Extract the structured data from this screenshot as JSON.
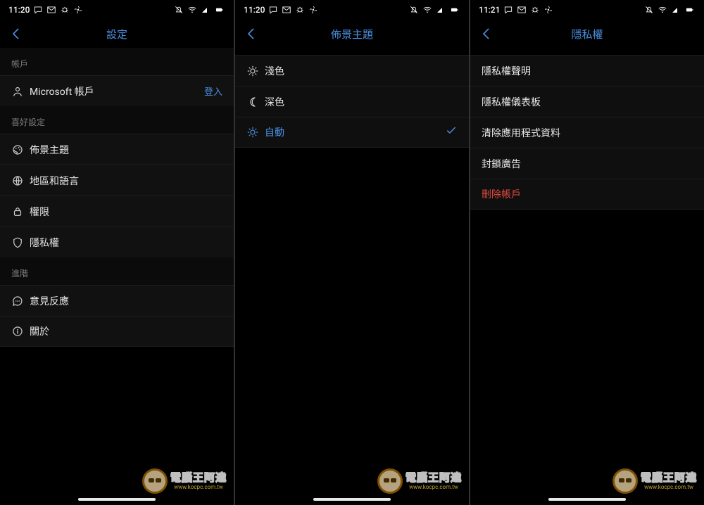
{
  "status": {
    "t1": "11:20",
    "t2": "11:20",
    "t3": "11:21"
  },
  "screen1": {
    "title": "設定",
    "sections": {
      "account": "帳戶",
      "prefs": "喜好設定",
      "advanced": "進階"
    },
    "rows": {
      "msAccount": "Microsoft 帳戶",
      "msAccountAction": "登入",
      "theme": "佈景主題",
      "region": "地區和語言",
      "permissions": "權限",
      "privacy": "隱私權",
      "feedback": "意見反應",
      "about": "關於"
    }
  },
  "screen2": {
    "title": "佈景主題",
    "rows": {
      "light": "淺色",
      "dark": "深色",
      "auto": "自動"
    }
  },
  "screen3": {
    "title": "隱私權",
    "rows": {
      "statement": "隱私權聲明",
      "dashboard": "隱私權儀表板",
      "clear": "清除應用程式資料",
      "block": "封鎖廣告",
      "delete": "刪除帳戶"
    }
  },
  "watermark": {
    "main": "電腦王阿達",
    "sub": "www.kocpc.com.tw"
  }
}
